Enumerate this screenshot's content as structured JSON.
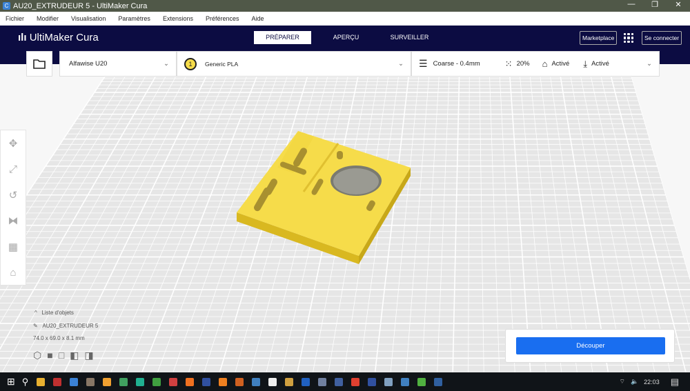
{
  "window": {
    "title": "AU20_EXTRUDEUR 5 - UltiMaker Cura",
    "app_icon": "C",
    "controls": [
      "—",
      "❐",
      "✕"
    ]
  },
  "menu": [
    "Fichier",
    "Modifier",
    "Visualisation",
    "Paramètres",
    "Extensions",
    "Préférences",
    "Aide"
  ],
  "header": {
    "logo": "UltiMaker Cura",
    "tabs": [
      "PRÉPARER",
      "APERÇU",
      "SURVEILLER"
    ],
    "marketplace": "Marketplace",
    "signin": "Se connecter"
  },
  "toolbar": {
    "printer": "Alfawise U20",
    "extruder_number": "1",
    "material": "Generic PLA",
    "profile": "Coarse - 0.4mm",
    "infill": "20%",
    "support": "Activé",
    "adhesion": "Activé"
  },
  "objects": {
    "list_label": "Liste d'objets",
    "name": "AU20_EXTRUDEUR 5",
    "dimensions": "74.0 x 69.0 x 8.1 mm"
  },
  "slice": {
    "label": "Découper"
  },
  "taskbar": {
    "time": "22:03",
    "app_colors": [
      "#e8b030",
      "#c03030",
      "#3b82d6",
      "#887766",
      "#f0a030",
      "#40a060",
      "#20b090",
      "#40a040",
      "#d04040",
      "#f07020",
      "#3050a0",
      "#f08020",
      "#d06020",
      "#4080c0",
      "#eee",
      "#d0a040",
      "#2060c0",
      "#7080a0",
      "#4060a0",
      "#e04030",
      "#3050a0",
      "#80a0c0",
      "#4080c0",
      "#50b040",
      "#3060a0"
    ]
  }
}
